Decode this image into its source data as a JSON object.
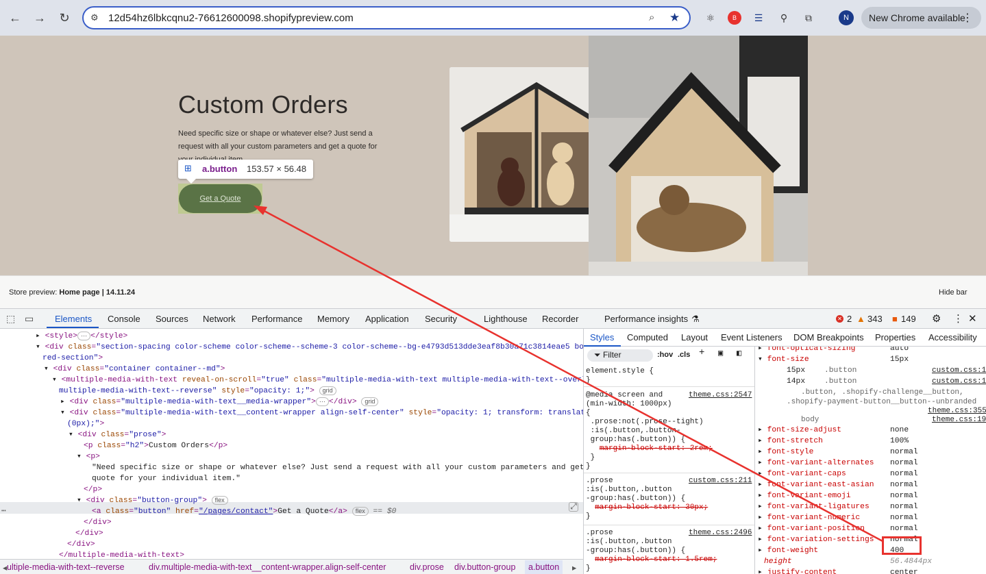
{
  "browser": {
    "url": "12d54hz6lbkcqnu2-76612600098.shopifypreview.com",
    "profile_initial": "N",
    "new_chrome_label": "New Chrome available"
  },
  "page": {
    "title": "Custom Orders",
    "text": "Need specific size or shape or whatever else? Just send a request with all your custom parameters and get a quote for your individual item.",
    "button_label": "Get a Quote",
    "tooltip_name": "a.button",
    "tooltip_size": "153.57 × 56.48"
  },
  "preview_bar": {
    "label_prefix": "Store preview:",
    "label_value": "Home page | 14.11.24",
    "hide_label": "Hide bar"
  },
  "devtools": {
    "tabs": [
      "Elements",
      "Console",
      "Sources",
      "Network",
      "Performance",
      "Memory",
      "Application",
      "Security",
      "Lighthouse",
      "Recorder",
      "Performance insights"
    ],
    "errors": "2",
    "warnings": "343",
    "info": "149",
    "styles_tabs": [
      "Styles",
      "Computed",
      "Layout",
      "Event Listeners",
      "DOM Breakpoints",
      "Properties",
      "Accessibility"
    ],
    "filter_placeholder": "Filter",
    "hov": ":hov",
    "cls": ".cls",
    "breadcrumb": [
      "ultiple-media-with-text--reverse",
      "div.multiple-media-with-text__content-wrapper.align-self-center",
      "div.prose",
      "div.button-group",
      "a.button"
    ],
    "computed": [
      {
        "name": "font-optical-sizing",
        "value": "auto"
      },
      {
        "name": "font-size",
        "value": "15px"
      },
      {
        "name": "font-size-adjust",
        "value": "none"
      },
      {
        "name": "font-stretch",
        "value": "100%"
      },
      {
        "name": "font-style",
        "value": "normal"
      },
      {
        "name": "font-variant-alternates",
        "value": "normal"
      },
      {
        "name": "font-variant-caps",
        "value": "normal"
      },
      {
        "name": "font-variant-east-asian",
        "value": "normal"
      },
      {
        "name": "font-variant-emoji",
        "value": "normal"
      },
      {
        "name": "font-variant-ligatures",
        "value": "normal"
      },
      {
        "name": "font-variant-numeric",
        "value": "normal"
      },
      {
        "name": "font-variant-position",
        "value": "normal"
      },
      {
        "name": "font-variation-settings",
        "value": "normal"
      },
      {
        "name": "font-weight",
        "value": "400"
      },
      {
        "name": "height",
        "value": "56.4844px"
      },
      {
        "name": "justify-content",
        "value": "center"
      }
    ],
    "font_size_trace": [
      {
        "value": "15px",
        "selector": ".button",
        "source": "custom.css:1"
      },
      {
        "value": "14px",
        "selector": ".button",
        "source": "custom.css:1"
      }
    ],
    "font_size_trace_extra": [
      ".button, .shopify-challenge__button,",
      ".shopify-payment-button__button--unbranded"
    ],
    "font_size_trace_sources": [
      "theme.css:355",
      "theme.css:19"
    ],
    "body_label": "body",
    "rules": {
      "element_style": "element.style {",
      "rule1_source": "theme.css:2547",
      "rule2_source": "custom.css:211",
      "rule3_source": "theme.css:2496",
      "margin1": "margin-block-start: 2rem;",
      "margin2": "margin-block-start: 30px;",
      "margin3": "margin-block-start: 1.5rem;"
    }
  }
}
